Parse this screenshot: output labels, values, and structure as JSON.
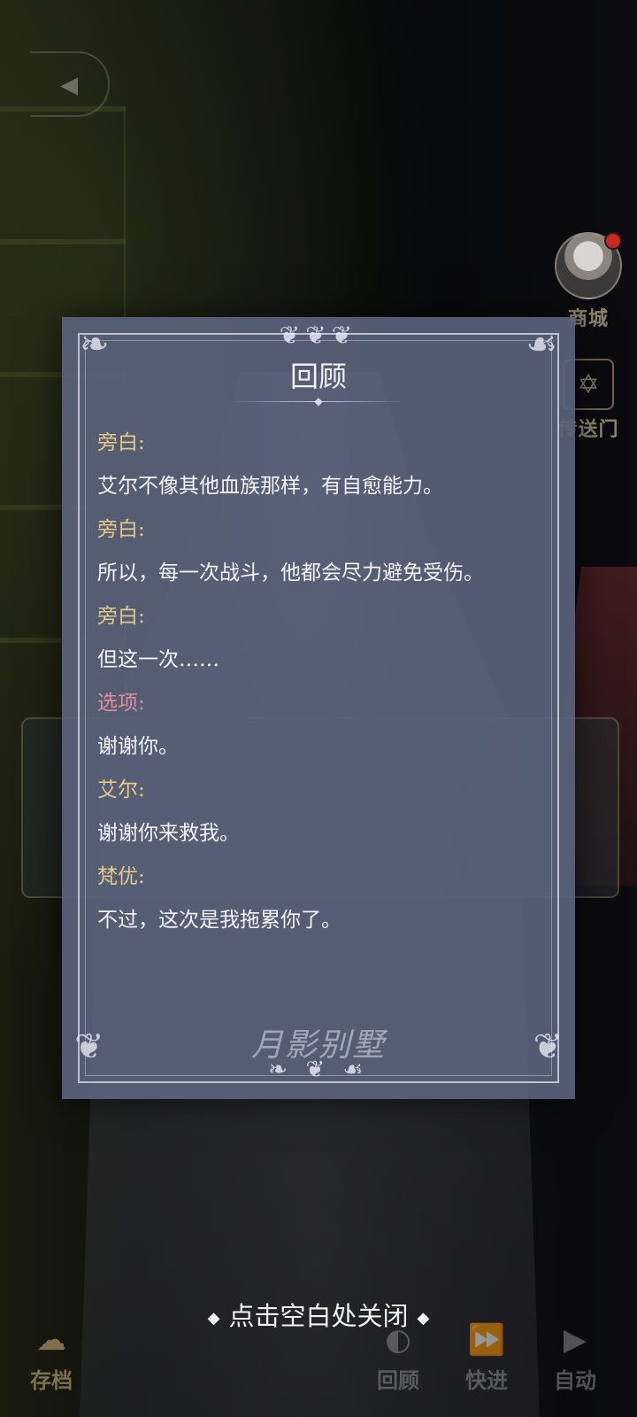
{
  "modal": {
    "title": "回顾",
    "entries": [
      {
        "speaker": "旁白:",
        "text": "艾尔不像其他血族那样，有自愈能力。"
      },
      {
        "speaker": "旁白:",
        "text": "所以，每一次战斗，他都会尽力避免受伤。"
      },
      {
        "speaker": "旁白:",
        "text": "但这一次……"
      },
      {
        "speaker": "选项:",
        "text": "谢谢你。"
      },
      {
        "speaker": "艾尔:",
        "text": "谢谢你来救我。"
      },
      {
        "speaker": "梵优:",
        "text": "不过，这次是我拖累你了。"
      }
    ],
    "logo_text": "月影别墅"
  },
  "close_hint": "点击空白处关闭",
  "side": {
    "shop_label": "商城",
    "portal_label": "传送门"
  },
  "toolbar": {
    "save_label": "存档",
    "review_label": "回顾",
    "fast_label": "快进",
    "auto_label": "自动"
  },
  "colors": {
    "modal_bg": "#58627a",
    "speaker_narration": "#e6c88a",
    "speaker_option": "#e38c9c",
    "dialog_text": "#f3f3f6"
  }
}
